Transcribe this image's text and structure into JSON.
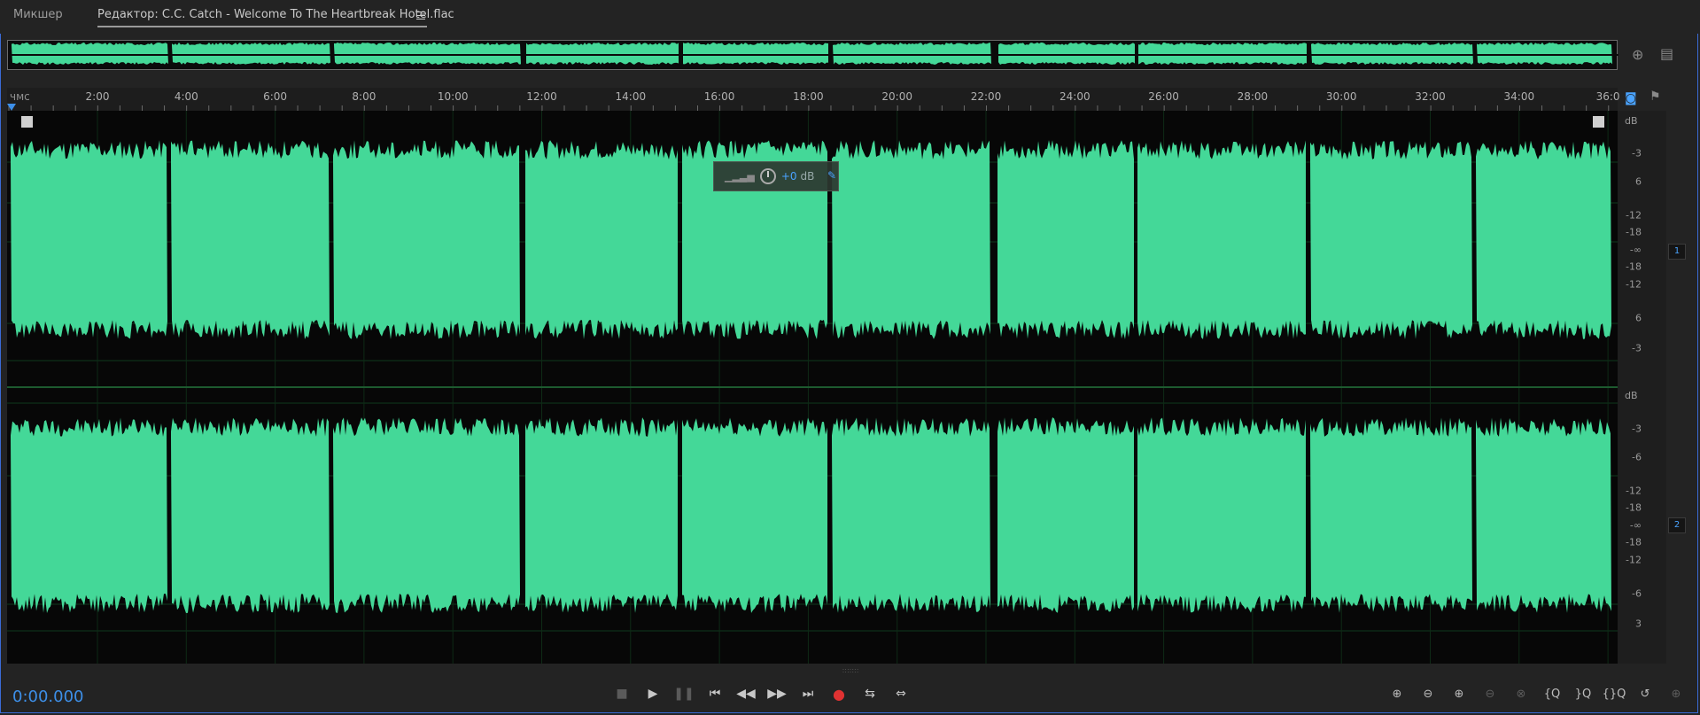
{
  "tabs": {
    "mixer": "Микшер",
    "editor": "Редактор: C.C. Catch - Welcome To The Heartbreak Hotel.flac"
  },
  "ruler": {
    "unit": "чмс",
    "labels": [
      "2:00",
      "4:00",
      "6:00",
      "8:00",
      "10:00",
      "12:00",
      "14:00",
      "16:00",
      "18:00",
      "20:00",
      "22:00",
      "24:00",
      "26:00",
      "28:00",
      "30:00",
      "32:00",
      "34:00",
      "36:0"
    ]
  },
  "gain_hud": {
    "value": "+0",
    "unit": "dB"
  },
  "db_scale": {
    "unit": "dB",
    "ch1": [
      "-3",
      "6",
      "-12",
      "-18",
      "-∞",
      "-18",
      "-12",
      "6",
      "-3"
    ],
    "ch2": [
      "-3",
      "-6",
      "-12",
      "-18",
      "-∞",
      "-18",
      "-12",
      "-6",
      "3"
    ]
  },
  "channels": [
    "1",
    "2"
  ],
  "transport": {
    "time": "0:00.000",
    "buttons": [
      "stop",
      "play",
      "pause",
      "to-start",
      "rewind",
      "fast-forward",
      "to-end",
      "record",
      "loop",
      "skip-selection"
    ]
  },
  "zoom_buttons": [
    "zoom-in-amplitude",
    "zoom-out-amplitude",
    "zoom-in-time",
    "zoom-out-time",
    "zoom-out-full",
    "zoom-in-start",
    "zoom-in-end",
    "zoom-selection",
    "zoom-reset"
  ],
  "colors": {
    "waveform": "#44d898",
    "accent": "#3d8fe8",
    "record": "#e03232"
  }
}
